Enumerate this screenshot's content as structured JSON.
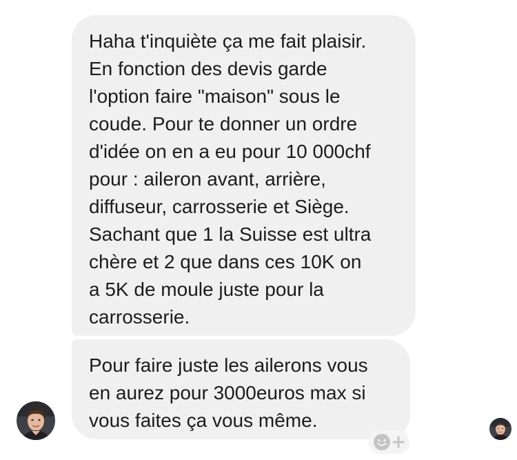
{
  "conversation": {
    "messages": [
      {
        "sender": "contact",
        "text": "Haha t'inquiète ça me fait plaisir.\nEn fonction des devis garde\nl'option faire \"maison\" sous le\ncoude. Pour te donner un ordre\nd'idée on en a eu pour 10 000chf\npour : aileron avant, arrière,\ndiffuseur, carrosserie et Siège.\nSachant que 1 la Suisse est ultra\nchère et 2 que dans ces 10K on\na 5K de moule juste pour la\ncarrosserie."
      },
      {
        "sender": "contact",
        "text": "Pour faire juste les ailerons vous\nen aurez pour 3000euros max si\nvous faites ça vous même."
      }
    ]
  },
  "colors": {
    "bubble_background": "#f0f0f0",
    "text": "#1c1c1e",
    "reaction_icon": "#c4c4c4"
  },
  "icons": {
    "reaction": "smiley-plus-icon",
    "avatar": "person-avatar-icon"
  }
}
